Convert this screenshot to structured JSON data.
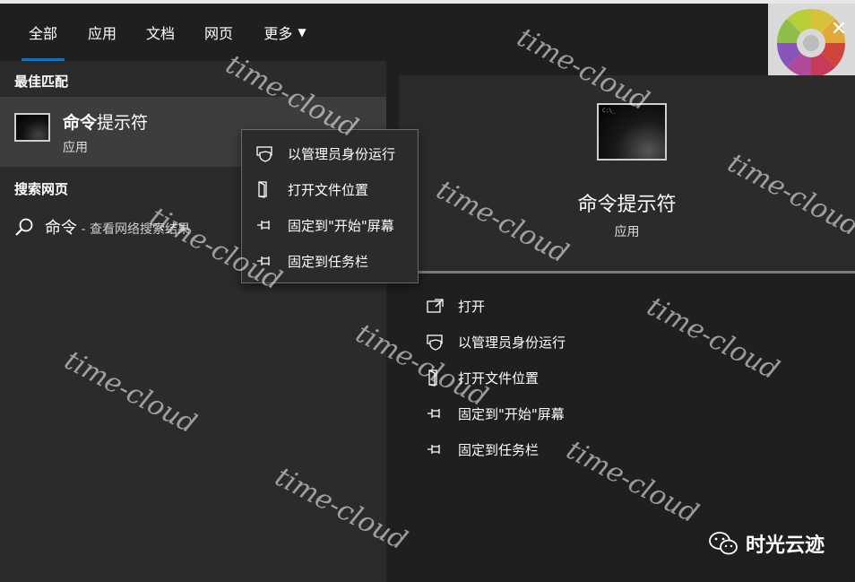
{
  "tabs": [
    {
      "label": "全部",
      "active": true
    },
    {
      "label": "应用",
      "active": false
    },
    {
      "label": "文档",
      "active": false
    },
    {
      "label": "网页",
      "active": false
    },
    {
      "label": "更多",
      "active": false,
      "dropdown": true
    }
  ],
  "close_glyph": "✕",
  "left": {
    "best_match_header": "最佳匹配",
    "best_match": {
      "title_bold": "命令",
      "title_rest": "提示符",
      "subtitle": "应用"
    },
    "web_header": "搜索网页",
    "web_result": {
      "query": "命令",
      "hint": " - 查看网络搜索结果"
    }
  },
  "context_menu": [
    {
      "label": "以管理员身份运行",
      "icon": "shield-icon"
    },
    {
      "label": "打开文件位置",
      "icon": "folder-icon"
    },
    {
      "label": "固定到\"开始\"屏幕",
      "icon": "pin-icon"
    },
    {
      "label": "固定到任务栏",
      "icon": "pin-icon"
    }
  ],
  "preview": {
    "title": "命令提示符",
    "subtitle": "应用",
    "icon_text": "C:\\_"
  },
  "actions": [
    {
      "label": "打开",
      "icon": "open-icon"
    },
    {
      "label": "以管理员身份运行",
      "icon": "shield-icon"
    },
    {
      "label": "打开文件位置",
      "icon": "folder-icon"
    },
    {
      "label": "固定到\"开始\"屏幕",
      "icon": "pin-icon"
    },
    {
      "label": "固定到任务栏",
      "icon": "pin-icon"
    }
  ],
  "watermark": "time-cloud",
  "brand": {
    "label": "时光云迹",
    "icon": "wechat-icon"
  },
  "colors": {
    "accent": "#0078d7",
    "pane": "#2b2b2b",
    "selected": "#3d3d3d"
  }
}
